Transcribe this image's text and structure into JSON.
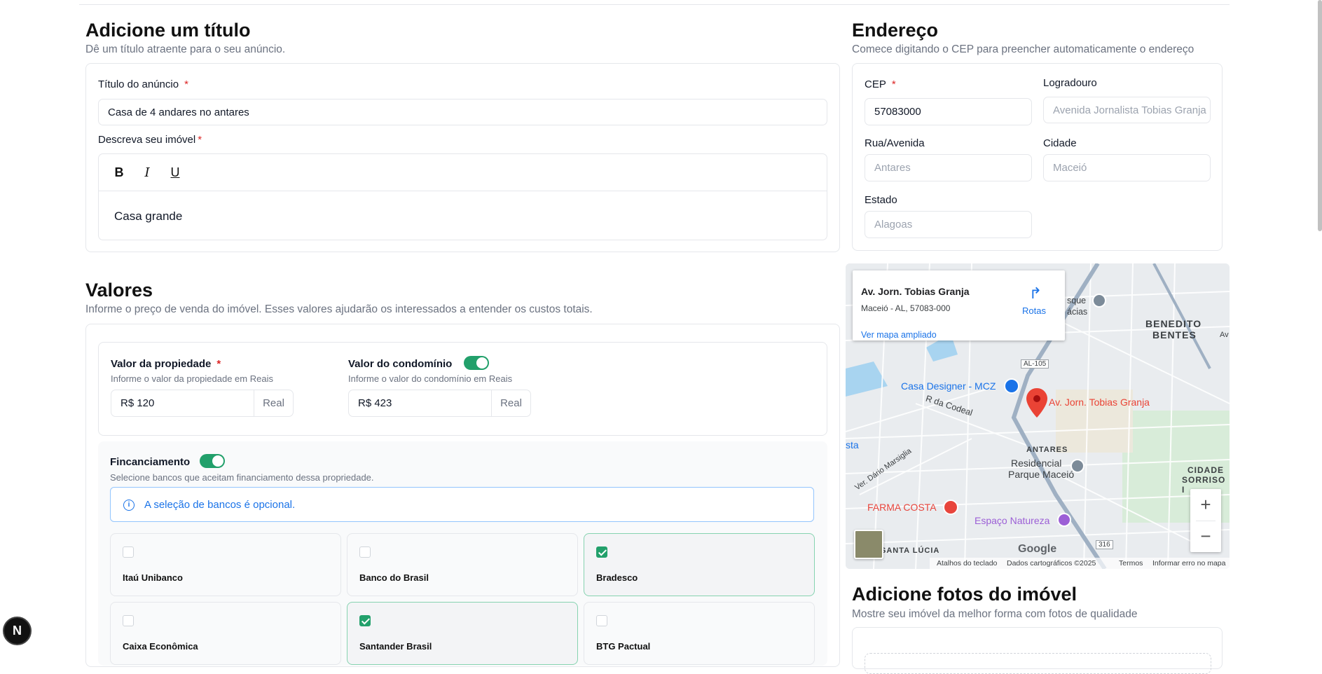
{
  "title_section": {
    "heading": "Adicione um título",
    "subtitle": "Dê um título atraente para o seu anúncio.",
    "title_label": "Título do anúncio",
    "title_required": "*",
    "title_value": "Casa de 4 andares no antares",
    "description_label": "Descreva seu imóvel",
    "description_required": "*",
    "editor_bold": "B",
    "editor_italic": "I",
    "editor_underline": "U",
    "description_value": "Casa grande"
  },
  "address": {
    "heading": "Endereço",
    "subtitle": "Comece digitando o CEP para preencher automaticamente o endereço",
    "cep_label": "CEP",
    "cep_required": "*",
    "cep_value": "57083000",
    "logradouro_label": "Logradouro",
    "logradouro_value": "Avenida Jornalista Tobias Granja",
    "rua_label": "Rua/Avenida",
    "rua_value": "Antares",
    "cidade_label": "Cidade",
    "cidade_value": "Maceió",
    "estado_label": "Estado",
    "estado_value": "Alagoas"
  },
  "map": {
    "place_name": "Av. Jorn. Tobias Granja",
    "place_address": "Maceió - AL, 57083-000",
    "directions_label": "Rotas",
    "larger_map_link": "Ver mapa ampliado",
    "pin_label": "Av. Jorn. Tobias Granja",
    "labels": {
      "casa_designer": "Casa Designer - MCZ",
      "codeal": "R da Codeal",
      "benedito": "BENEDITO",
      "bentes": "BENTES",
      "antares": "ANTARES",
      "residencial1": "Residencial",
      "residencial2": "Parque Maceió",
      "farma": "FARMA COSTA",
      "espaco": "Espaço Natureza",
      "cidade1": "CIDADE",
      "cidade2": "SORRISO I",
      "santa_lucia": "SANTA LÚCIA",
      "dario": "Ver. Dário Marsiglia",
      "al105": "AL-105",
      "r316": "316",
      "esque": "sque",
      "acias": "ácias",
      "sta": "sta",
      "av": "Av"
    },
    "zoom_in": "+",
    "zoom_out": "−",
    "google": "Google",
    "footer_shortcuts": "Atalhos do teclado",
    "footer_data": "Dados cartográficos ©2025",
    "footer_terms": "Termos",
    "footer_report": "Informar erro no mapa"
  },
  "valores": {
    "heading": "Valores",
    "subtitle": "Informe o preço de venda do imóvel. Esses valores ajudarão os interessados a entender os custos totais.",
    "property_label": "Valor da propiedade",
    "property_required": "*",
    "property_hint": "Informe o valor da propiedade em Reais",
    "property_value": "R$ 120",
    "property_unit": "Real",
    "condo_label": "Valor do condomínio",
    "condo_toggle_on": true,
    "condo_hint": "Informe o valor do condomínio em Reais",
    "condo_value": "R$ 423",
    "condo_unit": "Real"
  },
  "financing": {
    "label": "Fincanciamento",
    "toggle_on": true,
    "hint": "Selecione bancos que aceitam financiamento dessa propriedade.",
    "info": "A seleção de bancos é opcional.",
    "banks": [
      {
        "name": "Itaú Unibanco",
        "checked": false
      },
      {
        "name": "Banco do Brasil",
        "checked": false
      },
      {
        "name": "Bradesco",
        "checked": true
      },
      {
        "name": "Caixa Econômica",
        "checked": false
      },
      {
        "name": "Santander Brasil",
        "checked": true
      },
      {
        "name": "BTG Pactual",
        "checked": false
      }
    ]
  },
  "photos": {
    "heading": "Adicione fotos do imóvel",
    "subtitle": "Mostre seu imóvel da melhor forma com fotos de qualidade"
  },
  "badge": {
    "letter": "N"
  },
  "colors": {
    "accent": "#22a06b",
    "required": "#dc2626",
    "info": "#1a73e8",
    "pin": "#ea4335"
  }
}
